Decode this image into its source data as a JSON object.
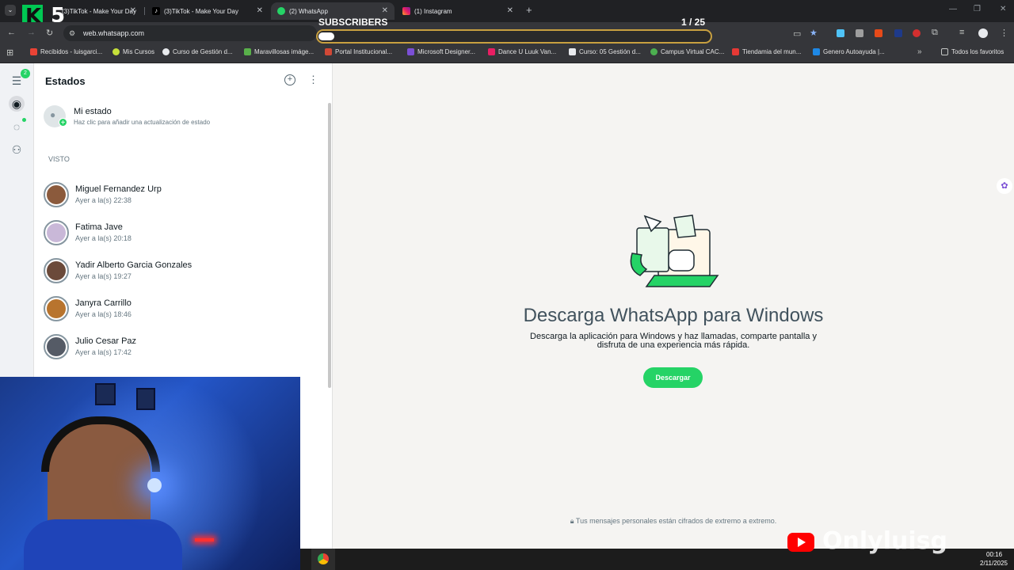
{
  "browser": {
    "tabs": [
      {
        "label": "(3)TikTok - Make Your Day",
        "active": false
      },
      {
        "label": "(3)TikTok - Make Your Day",
        "active": false
      },
      {
        "label": "(2) WhatsApp",
        "active": true
      },
      {
        "label": "(1) Instagram",
        "active": false
      }
    ],
    "url": "web.whatsapp.com",
    "bookmarks": [
      {
        "label": "Recibidos - luisgarci...",
        "color": "#ea4335"
      },
      {
        "label": "Mis Cursos",
        "color": "#c6e03a"
      },
      {
        "label": "Curso de Gestión d...",
        "color": "#e8eaed"
      },
      {
        "label": "Maravillosas imáge...",
        "color": "#59b04a"
      },
      {
        "label": "Portal Institucional...",
        "color": "#d14836"
      },
      {
        "label": "Microsoft Designer...",
        "color": "#7b4fd6"
      },
      {
        "label": "Dance U Luuk Van...",
        "color": "#e91e63"
      },
      {
        "label": "Curso: 05 Gestión d...",
        "color": "#e8eaed"
      },
      {
        "label": "Campus Virtual CAC...",
        "color": "#4caf50"
      },
      {
        "label": "Tiendamia del mun...",
        "color": "#e53935"
      },
      {
        "label": "Genero Autoayuda |...",
        "color": "#1e88e5"
      }
    ],
    "all_bookmarks": "Todos los favoritos"
  },
  "overlay": {
    "k5_number": "5",
    "subscribers_label": "SUBSCRIBERS",
    "subscribers_count": "1 / 25",
    "subscribers_progress": 0.04,
    "watermark": "Onlyluisg"
  },
  "whatsapp": {
    "rail_badge": "2",
    "panel_title": "Estados",
    "my_status": {
      "name": "Mi estado",
      "hint": "Haz clic para añadir una actualización de estado"
    },
    "section_label": "VISTO",
    "statuses": [
      {
        "name": "Miguel Fernandez Urp",
        "time": "Ayer a la(s) 22:38",
        "color": "#8b5a3c"
      },
      {
        "name": "Fatima Jave",
        "time": "Ayer a la(s) 20:18",
        "color": "#c9b8d8"
      },
      {
        "name": "Yadir Alberto Garcia Gonzales",
        "time": "Ayer a la(s) 19:27",
        "color": "#6b4a3a"
      },
      {
        "name": "Janyra Carrillo",
        "time": "Ayer a la(s) 18:46",
        "color": "#b8742e"
      },
      {
        "name": "Julio Cesar Paz",
        "time": "Ayer a la(s) 17:42",
        "color": "#555b66"
      }
    ],
    "main_title": "Descarga WhatsApp para Windows",
    "main_subtitle_1": "Descarga la aplicación para Windows y haz llamadas, comparte pantalla y",
    "main_subtitle_2": "disfruta de una experiencia más rápida.",
    "download_button": "Descargar",
    "encryption_note": "Tus mensajes personales están cifrados de extremo a extremo."
  },
  "taskbar": {
    "time": "00:16",
    "date": "2/11/2025"
  }
}
